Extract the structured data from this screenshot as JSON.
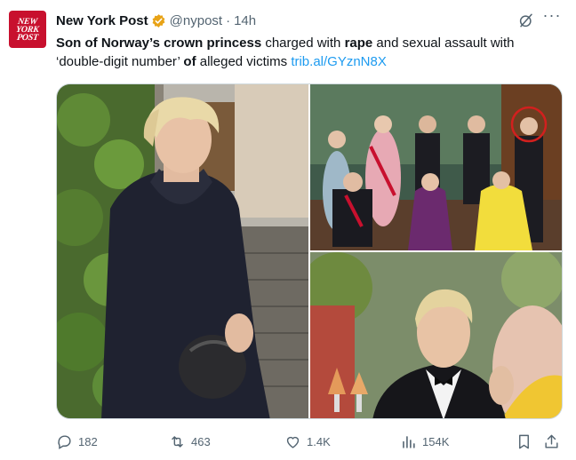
{
  "tweet": {
    "avatar_lines": [
      "NEW",
      "YORK",
      "POST"
    ],
    "display_name": "New York Post",
    "handle": "@nypost",
    "separator": "·",
    "time": "14h",
    "text_parts": [
      {
        "t": "Son of Norway’s crown princess",
        "b": true
      },
      {
        "t": " charged with ",
        "b": false
      },
      {
        "t": "rape",
        "b": true
      },
      {
        "t": " and sexual assault with ‘double-digit number’ ",
        "b": false
      },
      {
        "t": "of",
        "b": true
      },
      {
        "t": " alleged victims ",
        "b": false
      }
    ],
    "link_text": "trib.al/GYznN8X",
    "more_label": "···"
  },
  "media": {
    "photos": [
      "young-man-hoodie-photo",
      "royal-family-group-photo",
      "gala-dinner-photo"
    ]
  },
  "actions": {
    "replies": "182",
    "reposts": "463",
    "likes": "1.4K",
    "views": "154K"
  },
  "colors": {
    "brand": "#c8102e",
    "link": "#1d9bf0",
    "muted": "#536471",
    "verified_gold": "#e8a317"
  }
}
